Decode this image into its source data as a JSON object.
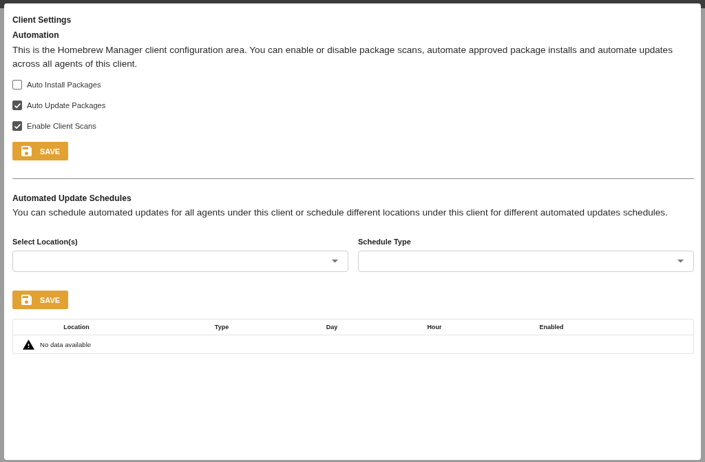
{
  "dialog": {
    "title": "Client Settings"
  },
  "automation": {
    "heading": "Automation",
    "description": "This is the Homebrew Manager client configuration area. You can enable or disable package scans, automate approved package installs and automate updates across all agents of this client.",
    "options": [
      {
        "label": "Auto Install Packages",
        "checked": false
      },
      {
        "label": "Auto Update Packages",
        "checked": true
      },
      {
        "label": "Enable Client Scans",
        "checked": true
      }
    ],
    "save_button": "SAVE"
  },
  "schedules": {
    "heading": "Automated Update Schedules",
    "description": "You can schedule automated updates for all agents under this client or schedule different locations under this client for different automated updates schedules.",
    "fields": [
      {
        "label": "Select Location(s)"
      },
      {
        "label": "Schedule Type"
      }
    ],
    "save_button": "SAVE",
    "table": {
      "columns": [
        "Location",
        "Type",
        "Day",
        "Hour",
        "Enabled"
      ],
      "empty_message": "No data available"
    }
  }
}
